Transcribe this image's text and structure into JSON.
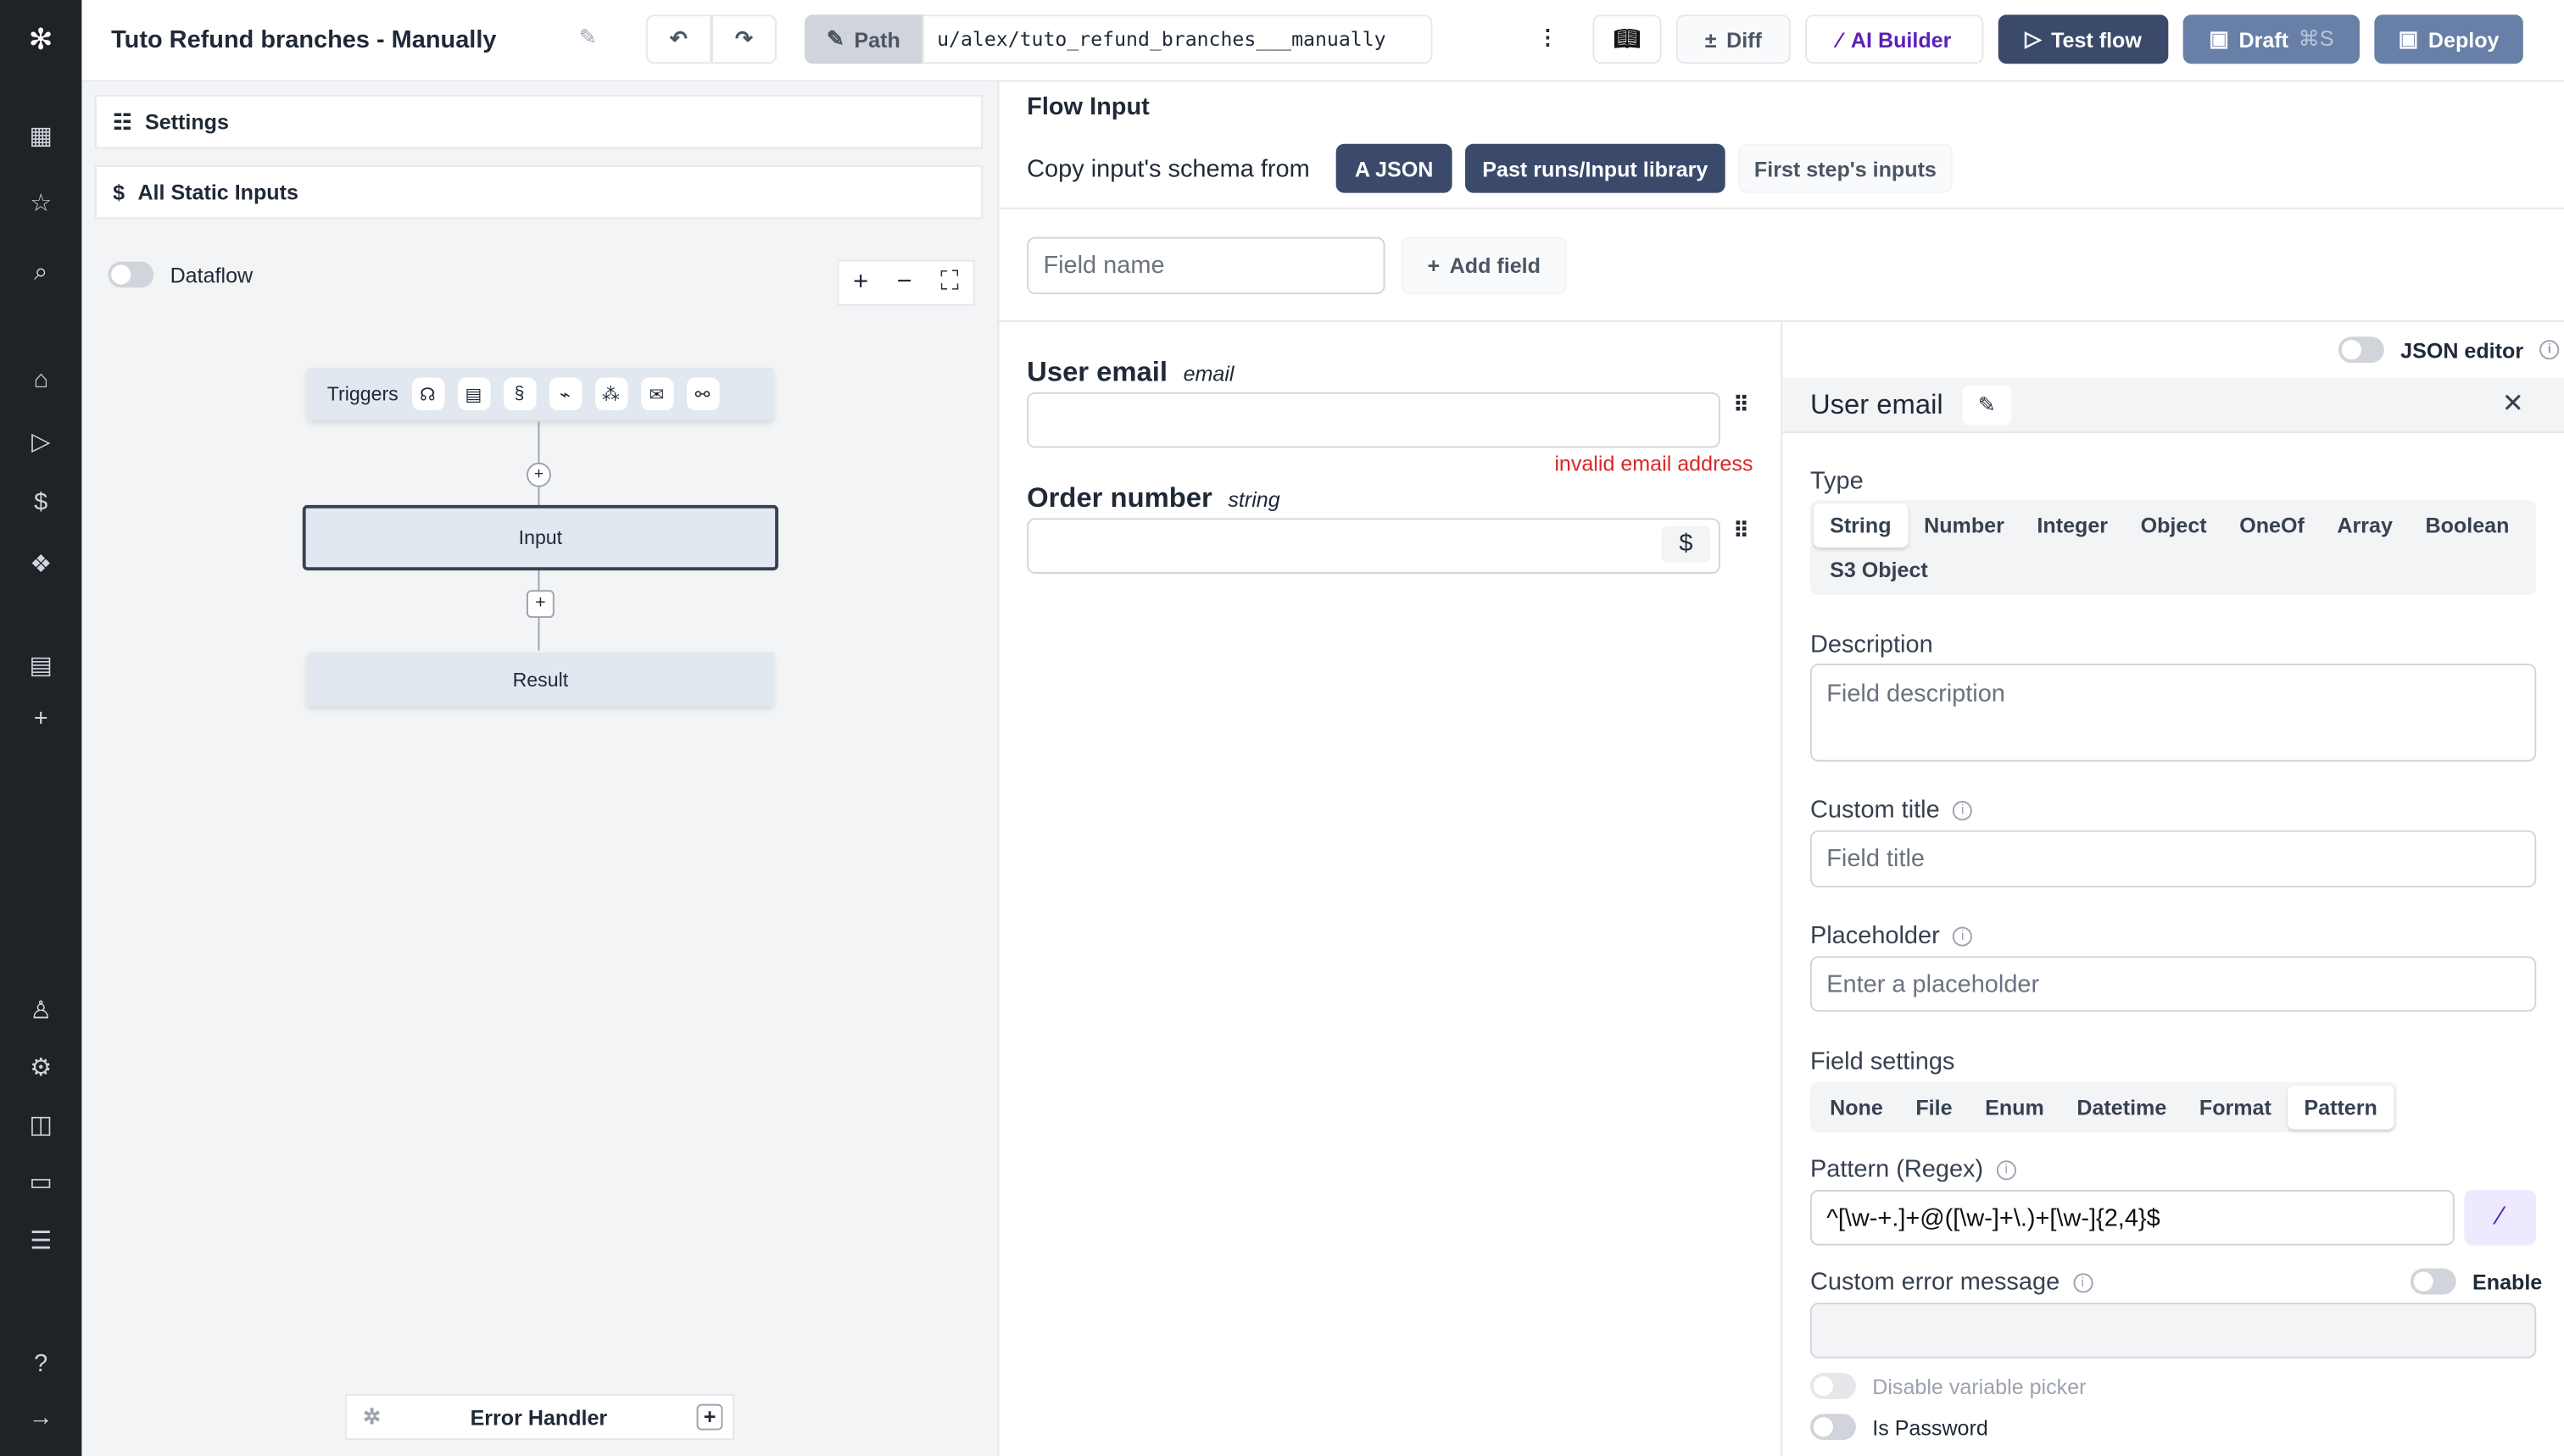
{
  "header": {
    "title": "Tuto Refund branches - Manually",
    "path_label": "Path",
    "path_value": "u/alex/tuto_refund_branches___manually",
    "diff": "Diff",
    "ai_builder": "AI Builder",
    "test_flow": "Test flow",
    "draft": "Draft",
    "draft_shortcut": "⌘S",
    "deploy": "Deploy"
  },
  "left": {
    "settings": "Settings",
    "static_inputs": "All Static Inputs",
    "dataflow": "Dataflow",
    "triggers": "Triggers",
    "input_node": "Input",
    "result_node": "Result",
    "error_handler": "Error Handler"
  },
  "flow_input": {
    "title": "Flow Input",
    "copy_label": "Copy input's schema from",
    "sources": [
      "A JSON",
      "Past runs/Input library",
      "First step's inputs"
    ],
    "field_name_placeholder": "Field name",
    "add_field": "Add field"
  },
  "fields": [
    {
      "name": "User email",
      "type": "email",
      "error": "invalid email address"
    },
    {
      "name": "Order number",
      "type": "string"
    }
  ],
  "editor": {
    "json_editor": "JSON editor",
    "title": "User email",
    "type_label": "Type",
    "types": [
      "String",
      "Number",
      "Integer",
      "Object",
      "OneOf",
      "Array",
      "Boolean",
      "S3 Object"
    ],
    "selected_type": "String",
    "description_label": "Description",
    "description_placeholder": "Field description",
    "custom_title_label": "Custom title",
    "custom_title_placeholder": "Field title",
    "placeholder_label": "Placeholder",
    "placeholder_placeholder": "Enter a placeholder",
    "field_settings_label": "Field settings",
    "settings": [
      "None",
      "File",
      "Enum",
      "Datetime",
      "Format",
      "Pattern"
    ],
    "selected_setting": "Pattern",
    "pattern_label": "Pattern (Regex)",
    "pattern_value": "^[\\w-+.]+@([\\w-]+\\.)+[\\w-]{2,4}$",
    "custom_error_label": "Custom error message",
    "enable": "Enable",
    "disable_picker": "Disable variable picker",
    "is_password": "Is Password"
  },
  "colors": {
    "sidebar": "#1f2328",
    "primary": "#3b4a6b",
    "draft": "#6880a8",
    "ai": "#5b21b6",
    "error": "#dc2626"
  }
}
